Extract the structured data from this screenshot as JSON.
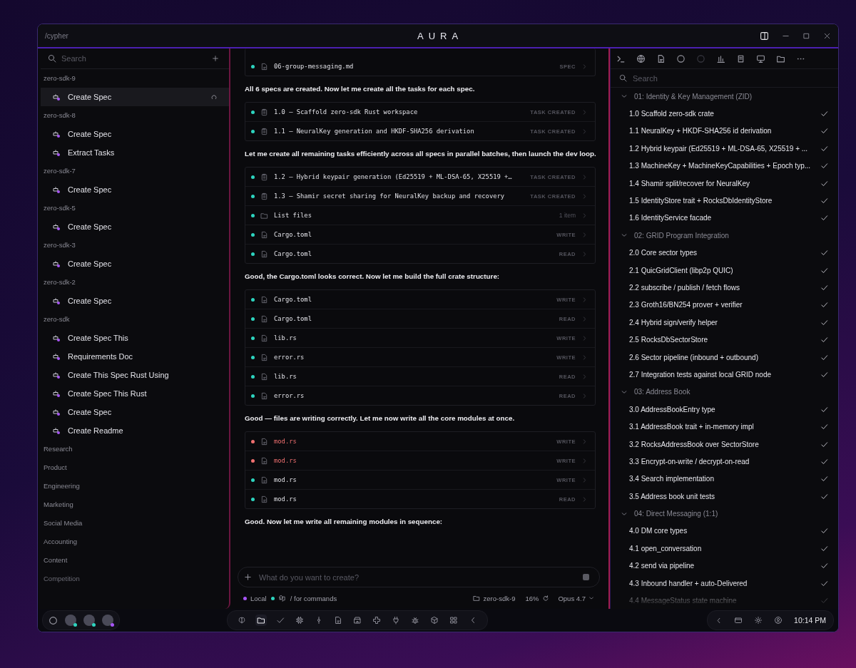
{
  "window": {
    "path": "/cypher",
    "logo": "AURA"
  },
  "sidebar": {
    "search": {
      "placeholder": "Search"
    },
    "groups": [
      {
        "name": "zero-sdk-9",
        "items": [
          {
            "label": "Create Spec",
            "selected": true,
            "loading": true
          }
        ]
      },
      {
        "name": "zero-sdk-8",
        "items": [
          {
            "label": "Create Spec",
            "selected": false,
            "loading": false
          },
          {
            "label": "Extract Tasks",
            "selected": false,
            "loading": false
          }
        ]
      },
      {
        "name": "zero-sdk-7",
        "items": [
          {
            "label": "Create Spec",
            "selected": false,
            "loading": false
          }
        ]
      },
      {
        "name": "zero-sdk-5",
        "items": [
          {
            "label": "Create Spec",
            "selected": false,
            "loading": false
          }
        ]
      },
      {
        "name": "zero-sdk-3",
        "items": [
          {
            "label": "Create Spec",
            "selected": false,
            "loading": false
          }
        ]
      },
      {
        "name": "zero-sdk-2",
        "items": [
          {
            "label": "Create Spec",
            "selected": false,
            "loading": false
          }
        ]
      },
      {
        "name": "zero-sdk",
        "items": [
          {
            "label": "Create Spec This",
            "selected": false,
            "loading": false
          },
          {
            "label": "Requirements Doc",
            "selected": false,
            "loading": false
          },
          {
            "label": "Create This Spec Rust Using",
            "selected": false,
            "loading": false
          },
          {
            "label": "Create Spec This Rust",
            "selected": false,
            "loading": false
          },
          {
            "label": "Create Spec",
            "selected": false,
            "loading": false
          },
          {
            "label": "Create Readme",
            "selected": false,
            "loading": false
          }
        ]
      }
    ],
    "categories": [
      "Research",
      "Product",
      "Engineering",
      "Marketing",
      "Social Media",
      "Accounting",
      "Content",
      "Competition"
    ]
  },
  "chat": {
    "blocks": [
      {
        "kind": "tools",
        "rows": [
          {
            "kind": "file",
            "name": "06-group-messaging.md",
            "action": "SPEC",
            "failed": false
          }
        ]
      },
      {
        "kind": "text",
        "text": "All 6 specs are created. Now let me create all the tasks for each spec."
      },
      {
        "kind": "tools",
        "rows": [
          {
            "kind": "task",
            "name": "1.0 — Scaffold zero-sdk Rust workspace",
            "action": "TASK CREATED",
            "failed": false
          },
          {
            "kind": "task",
            "name": "1.1 — NeuralKey generation and HKDF-SHA256 derivation",
            "action": "TASK CREATED",
            "failed": false
          }
        ]
      },
      {
        "kind": "text",
        "text": "Let me create all remaining tasks efficiently across all specs in parallel batches, then launch the dev loop."
      },
      {
        "kind": "tools",
        "rows": [
          {
            "kind": "task",
            "name": "1.2 — Hybrid keypair generation (Ed25519 + ML-DSA-65, X25519 +…",
            "action": "TASK CREATED",
            "failed": false
          },
          {
            "kind": "task",
            "name": "1.3 — Shamir secret sharing for NeuralKey backup and recovery",
            "action": "TASK CREATED",
            "failed": false
          },
          {
            "kind": "folder",
            "name": "List files",
            "action": "1 item",
            "failed": false
          },
          {
            "kind": "file",
            "name": "Cargo.toml",
            "action": "WRITE",
            "failed": false
          },
          {
            "kind": "file",
            "name": "Cargo.toml",
            "action": "READ",
            "failed": false
          }
        ]
      },
      {
        "kind": "text",
        "text": "Good, the Cargo.toml looks correct. Now let me build the full crate structure:"
      },
      {
        "kind": "tools",
        "rows": [
          {
            "kind": "file",
            "name": "Cargo.toml",
            "action": "WRITE",
            "failed": false
          },
          {
            "kind": "file",
            "name": "Cargo.toml",
            "action": "READ",
            "failed": false
          },
          {
            "kind": "file",
            "name": "lib.rs",
            "action": "WRITE",
            "failed": false
          },
          {
            "kind": "file",
            "name": "error.rs",
            "action": "WRITE",
            "failed": false
          },
          {
            "kind": "file",
            "name": "lib.rs",
            "action": "READ",
            "failed": false
          },
          {
            "kind": "file",
            "name": "error.rs",
            "action": "READ",
            "failed": false
          }
        ]
      },
      {
        "kind": "text",
        "text": "Good — files are writing correctly. Let me now write all the core modules at once."
      },
      {
        "kind": "tools",
        "rows": [
          {
            "kind": "file",
            "name": "mod.rs",
            "action": "WRITE",
            "failed": true
          },
          {
            "kind": "file",
            "name": "mod.rs",
            "action": "WRITE",
            "failed": true
          },
          {
            "kind": "file",
            "name": "mod.rs",
            "action": "WRITE",
            "failed": false
          },
          {
            "kind": "file",
            "name": "mod.rs",
            "action": "READ",
            "failed": false
          }
        ]
      },
      {
        "kind": "text",
        "text": "Good. Now let me write all remaining modules in sequence:"
      }
    ],
    "composer": {
      "placeholder": "What do you want to create?"
    },
    "status": {
      "mode": "Local",
      "hint": "/ for commands",
      "folder": "zero-sdk-9",
      "usage": "16%",
      "model": "Opus 4.7"
    }
  },
  "panel": {
    "search": {
      "placeholder": "Search"
    },
    "groups": [
      {
        "title": "01: Identity & Key Management (ZID)",
        "expanded": true,
        "children": [
          {
            "label": "1.0 Scaffold zero-sdk crate",
            "checked": true
          },
          {
            "label": "1.1 NeuralKey + HKDF-SHA256 id derivation",
            "checked": true
          },
          {
            "label": "1.2 Hybrid keypair (Ed25519 + ML-DSA-65, X25519 + ...",
            "checked": true
          },
          {
            "label": "1.3 MachineKey + MachineKeyCapabilities + Epoch typ...",
            "checked": true
          },
          {
            "label": "1.4 Shamir split/recover for NeuralKey",
            "checked": true
          },
          {
            "label": "1.5 IdentityStore trait + RocksDbIdentityStore",
            "checked": true
          },
          {
            "label": "1.6 IdentityService facade",
            "checked": true
          }
        ]
      },
      {
        "title": "02: GRID Program Integration",
        "expanded": true,
        "children": [
          {
            "label": "2.0 Core sector types",
            "checked": true
          },
          {
            "label": "2.1 QuicGridClient (libp2p QUIC)",
            "checked": true
          },
          {
            "label": "2.2 subscribe / publish / fetch flows",
            "checked": true
          },
          {
            "label": "2.3 Groth16/BN254 prover + verifier",
            "checked": true
          },
          {
            "label": "2.4 Hybrid sign/verify helper",
            "checked": true
          },
          {
            "label": "2.5 RocksDbSectorStore",
            "checked": true
          },
          {
            "label": "2.6 Sector pipeline (inbound + outbound)",
            "checked": true
          },
          {
            "label": "2.7 Integration tests against local GRID node",
            "checked": true
          }
        ]
      },
      {
        "title": "03: Address Book",
        "expanded": true,
        "children": [
          {
            "label": "3.0 AddressBookEntry type",
            "checked": true
          },
          {
            "label": "3.1 AddressBook trait + in-memory impl",
            "checked": true
          },
          {
            "label": "3.2 RocksAddressBook over SectorStore",
            "checked": true
          },
          {
            "label": "3.3 Encrypt-on-write / decrypt-on-read",
            "checked": true
          },
          {
            "label": "3.4 Search implementation",
            "checked": true
          },
          {
            "label": "3.5 Address book unit tests",
            "checked": true
          }
        ]
      },
      {
        "title": "04: Direct Messaging (1:1)",
        "expanded": true,
        "children": [
          {
            "label": "4.0 DM core types",
            "checked": true
          },
          {
            "label": "4.1 open_conversation",
            "checked": true
          },
          {
            "label": "4.2 send via pipeline",
            "checked": true
          },
          {
            "label": "4.3 Inbound handler + auto-Delivered",
            "checked": true
          },
          {
            "label": "4.4 MessageStatus state machine",
            "checked": true
          }
        ]
      }
    ]
  },
  "taskbar": {
    "users": [
      {
        "color": "#2dd4bf"
      },
      {
        "color": "#2dd4bf"
      },
      {
        "color": "#a855f7"
      }
    ],
    "apps": [
      {
        "selected": false
      },
      {
        "selected": true
      },
      {
        "selected": false
      },
      {
        "selected": false
      },
      {
        "selected": false
      },
      {
        "selected": false
      },
      {
        "selected": false
      },
      {
        "selected": false
      },
      {
        "selected": false
      },
      {
        "selected": false
      },
      {
        "selected": false
      },
      {
        "selected": false
      },
      {
        "selected": false
      }
    ],
    "time": "10:14 PM"
  }
}
